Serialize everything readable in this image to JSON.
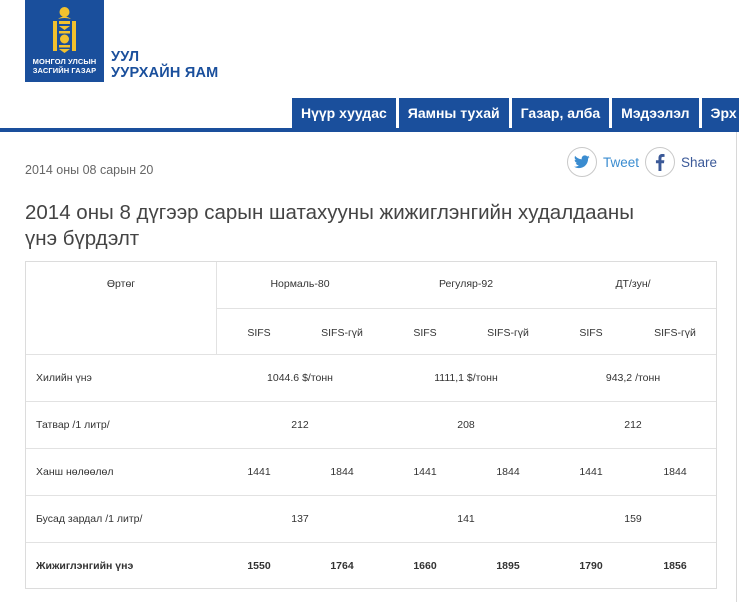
{
  "header": {
    "logo_line1": "МОНГОЛ УЛСЫН",
    "logo_line2": "ЗАСГИЙН ГАЗАР",
    "ministry_line1": "УУЛ",
    "ministry_line2": "УУРХАЙН ЯАМ"
  },
  "nav": {
    "items": [
      {
        "label": "Нүүр хуудас"
      },
      {
        "label": "Яамны тухай"
      },
      {
        "label": "Газар, алба"
      },
      {
        "label": "Мэдээлэл"
      },
      {
        "label": "Эрх зүй"
      }
    ]
  },
  "article": {
    "date": "2014 оны 08 сарын 20",
    "title_line1": "2014 оны 8 дүгээр сарын шатахууны жижиглэнгийн худалдааны",
    "title_line2": "үнэ бүрдэлт"
  },
  "share": {
    "tweet_label": "Tweet",
    "share_label": "Share"
  },
  "table": {
    "corner": "Өртөг",
    "fuel_headers": [
      "Нормаль-80",
      "Регуляр-92",
      "ДТ/зун/"
    ],
    "sub_headers": [
      "SIFS",
      "SIFS-гүй",
      "SIFS",
      "SIFS-гүй",
      "SIFS",
      "SIFS-гүй"
    ],
    "rows": [
      {
        "label": "Хилийн үнэ",
        "merged": [
          "1044.6 $/тонн",
          "1111,1 $/тонн",
          "943,2 /тонн"
        ]
      },
      {
        "label": "Татвар /1 литр/",
        "merged": [
          "212",
          "208",
          "212"
        ]
      },
      {
        "label": "Ханш нөлөөлөл",
        "values": [
          "1441",
          "1844",
          "1441",
          "1844",
          "1441",
          "1844"
        ]
      },
      {
        "label": "Бусад зардал /1 литр/",
        "merged": [
          "137",
          "141",
          "159"
        ]
      },
      {
        "label": "Жижиглэнгийн үнэ",
        "values": [
          "1550",
          "1764",
          "1660",
          "1895",
          "1790",
          "1856"
        ]
      }
    ]
  },
  "colors": {
    "brand_blue": "#1a4f9c",
    "twitter_blue": "#3a8cd0",
    "facebook_blue": "#3b5998"
  }
}
